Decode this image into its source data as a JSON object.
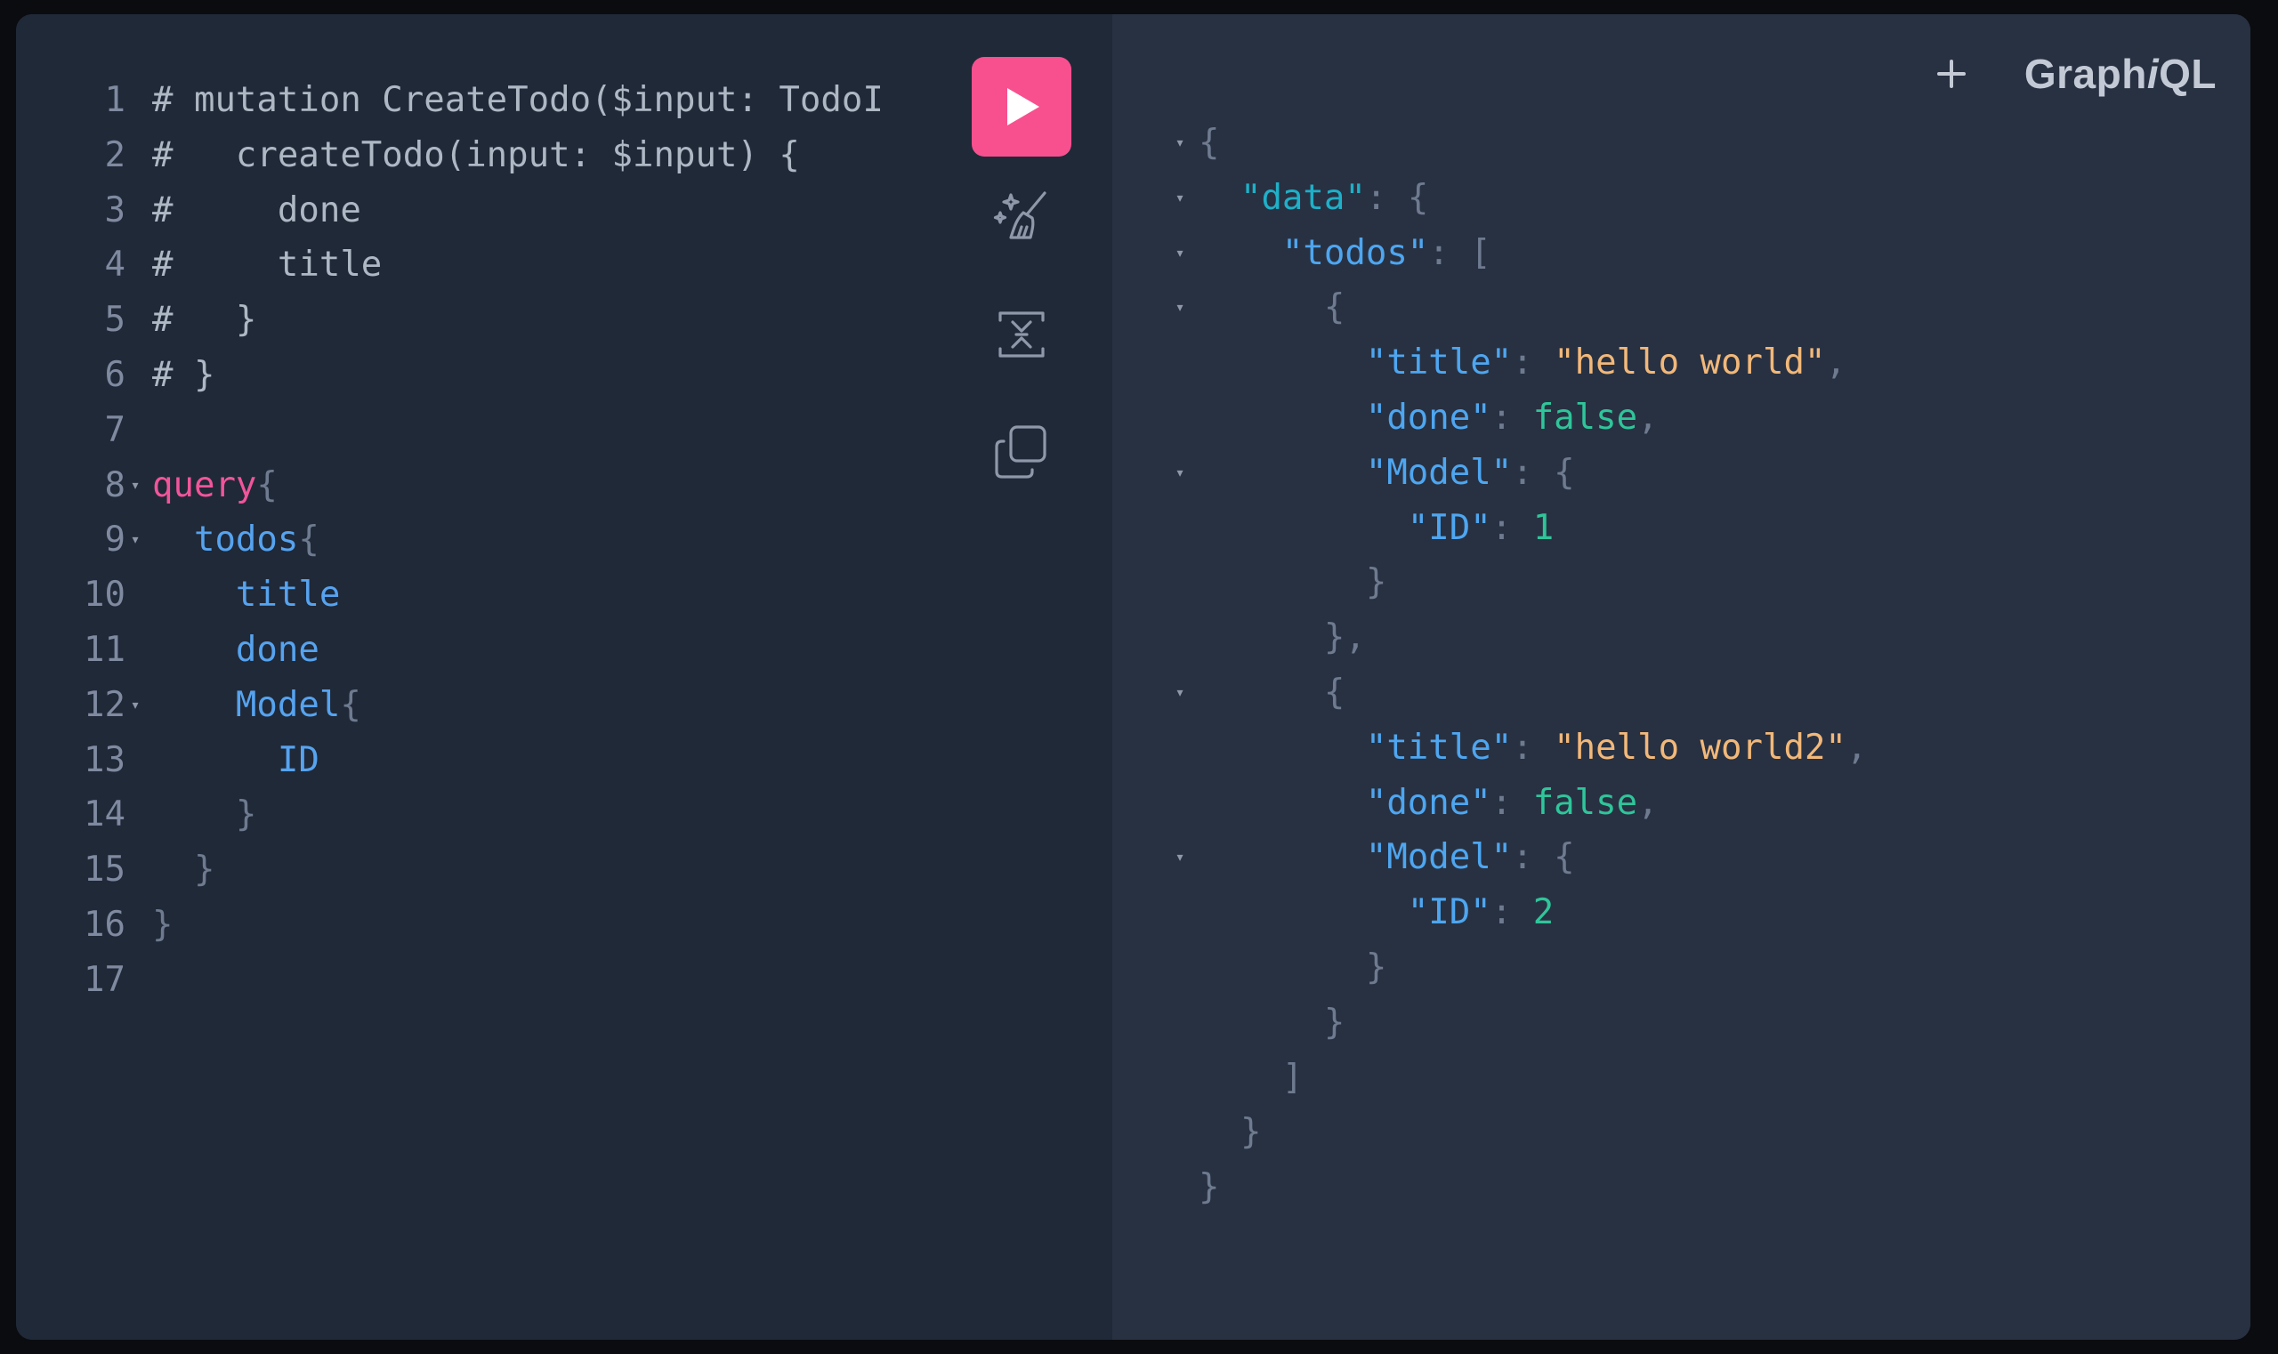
{
  "app": {
    "logo_prefix": "Graph",
    "logo_italic": "i",
    "logo_suffix": "QL"
  },
  "colors": {
    "run_button": "#f8508f",
    "background_editor": "#202938",
    "background_result": "#283142"
  },
  "toolbar": {
    "run_icon": "play-icon",
    "prettify_icon": "magic-broom-icon",
    "merge_icon": "merge-fragments-icon",
    "copy_icon": "copy-icon",
    "add_tab_icon": "plus-icon"
  },
  "editor": {
    "line_numbers": [
      "1",
      "2",
      "3",
      "4",
      "5",
      "6",
      "7",
      "8",
      "9",
      "10",
      "11",
      "12",
      "13",
      "14",
      "15",
      "16",
      "17"
    ],
    "lines": [
      {
        "indent": "",
        "tokens": [
          {
            "t": "# mutation CreateTodo($input: TodoI",
            "c": "comment"
          }
        ]
      },
      {
        "indent": "",
        "tokens": [
          {
            "t": "#   createTodo(input: $input) {",
            "c": "comment"
          }
        ]
      },
      {
        "indent": "",
        "tokens": [
          {
            "t": "#     done",
            "c": "comment"
          }
        ]
      },
      {
        "indent": "",
        "tokens": [
          {
            "t": "#     title",
            "c": "comment"
          }
        ]
      },
      {
        "indent": "",
        "tokens": [
          {
            "t": "#   }",
            "c": "comment"
          }
        ]
      },
      {
        "indent": "",
        "tokens": [
          {
            "t": "# }",
            "c": "comment"
          }
        ]
      },
      {
        "indent": "",
        "tokens": []
      },
      {
        "indent": "",
        "fold": true,
        "tokens": [
          {
            "t": "query",
            "c": "keyword"
          },
          {
            "t": "{",
            "c": "punct"
          }
        ]
      },
      {
        "indent": "  ",
        "fold": true,
        "tokens": [
          {
            "t": "todos",
            "c": "field"
          },
          {
            "t": "{",
            "c": "punct"
          }
        ]
      },
      {
        "indent": "    ",
        "tokens": [
          {
            "t": "title",
            "c": "field"
          }
        ]
      },
      {
        "indent": "    ",
        "tokens": [
          {
            "t": "done",
            "c": "field"
          }
        ]
      },
      {
        "indent": "    ",
        "fold": true,
        "tokens": [
          {
            "t": "Model",
            "c": "field"
          },
          {
            "t": "{",
            "c": "punct"
          }
        ]
      },
      {
        "indent": "      ",
        "tokens": [
          {
            "t": "ID",
            "c": "field"
          }
        ]
      },
      {
        "indent": "    ",
        "tokens": [
          {
            "t": "}",
            "c": "punct"
          }
        ]
      },
      {
        "indent": "  ",
        "tokens": [
          {
            "t": "}",
            "c": "punct"
          }
        ]
      },
      {
        "indent": "",
        "tokens": [
          {
            "t": "}",
            "c": "punct"
          }
        ]
      },
      {
        "indent": "",
        "tokens": []
      }
    ]
  },
  "result": {
    "lines": [
      {
        "fold": true,
        "indent": "",
        "tokens": [
          {
            "t": "{",
            "c": "punct"
          }
        ]
      },
      {
        "fold": true,
        "indent": "  ",
        "tokens": [
          {
            "t": "\"data\"",
            "c": "key-top"
          },
          {
            "t": ": {",
            "c": "punct"
          }
        ]
      },
      {
        "fold": true,
        "indent": "    ",
        "tokens": [
          {
            "t": "\"todos\"",
            "c": "key"
          },
          {
            "t": ": [",
            "c": "punct"
          }
        ]
      },
      {
        "fold": true,
        "indent": "      ",
        "tokens": [
          {
            "t": "{",
            "c": "punct"
          }
        ]
      },
      {
        "indent": "        ",
        "tokens": [
          {
            "t": "\"title\"",
            "c": "key"
          },
          {
            "t": ": ",
            "c": "punct"
          },
          {
            "t": "\"hello world\"",
            "c": "str"
          },
          {
            "t": ",",
            "c": "punct"
          }
        ]
      },
      {
        "indent": "        ",
        "tokens": [
          {
            "t": "\"done\"",
            "c": "key"
          },
          {
            "t": ": ",
            "c": "punct"
          },
          {
            "t": "false",
            "c": "bool"
          },
          {
            "t": ",",
            "c": "punct"
          }
        ]
      },
      {
        "fold": true,
        "indent": "        ",
        "tokens": [
          {
            "t": "\"Model\"",
            "c": "key"
          },
          {
            "t": ": {",
            "c": "punct"
          }
        ]
      },
      {
        "indent": "          ",
        "tokens": [
          {
            "t": "\"ID\"",
            "c": "key"
          },
          {
            "t": ": ",
            "c": "punct"
          },
          {
            "t": "1",
            "c": "num"
          }
        ]
      },
      {
        "indent": "        ",
        "tokens": [
          {
            "t": "}",
            "c": "punct"
          }
        ]
      },
      {
        "indent": "      ",
        "tokens": [
          {
            "t": "},",
            "c": "punct"
          }
        ]
      },
      {
        "fold": true,
        "indent": "      ",
        "tokens": [
          {
            "t": "{",
            "c": "punct"
          }
        ]
      },
      {
        "indent": "        ",
        "tokens": [
          {
            "t": "\"title\"",
            "c": "key"
          },
          {
            "t": ": ",
            "c": "punct"
          },
          {
            "t": "\"hello world2\"",
            "c": "str"
          },
          {
            "t": ",",
            "c": "punct"
          }
        ]
      },
      {
        "indent": "        ",
        "tokens": [
          {
            "t": "\"done\"",
            "c": "key"
          },
          {
            "t": ": ",
            "c": "punct"
          },
          {
            "t": "false",
            "c": "bool"
          },
          {
            "t": ",",
            "c": "punct"
          }
        ]
      },
      {
        "fold": true,
        "indent": "        ",
        "tokens": [
          {
            "t": "\"Model\"",
            "c": "key"
          },
          {
            "t": ": {",
            "c": "punct"
          }
        ]
      },
      {
        "indent": "          ",
        "tokens": [
          {
            "t": "\"ID\"",
            "c": "key"
          },
          {
            "t": ": ",
            "c": "punct"
          },
          {
            "t": "2",
            "c": "num"
          }
        ]
      },
      {
        "indent": "        ",
        "tokens": [
          {
            "t": "}",
            "c": "punct"
          }
        ]
      },
      {
        "indent": "      ",
        "tokens": [
          {
            "t": "}",
            "c": "punct"
          }
        ]
      },
      {
        "indent": "    ",
        "tokens": [
          {
            "t": "]",
            "c": "punct"
          }
        ]
      },
      {
        "indent": "  ",
        "tokens": [
          {
            "t": "}",
            "c": "punct"
          }
        ]
      },
      {
        "indent": "",
        "tokens": [
          {
            "t": "}",
            "c": "punct"
          }
        ]
      }
    ]
  }
}
